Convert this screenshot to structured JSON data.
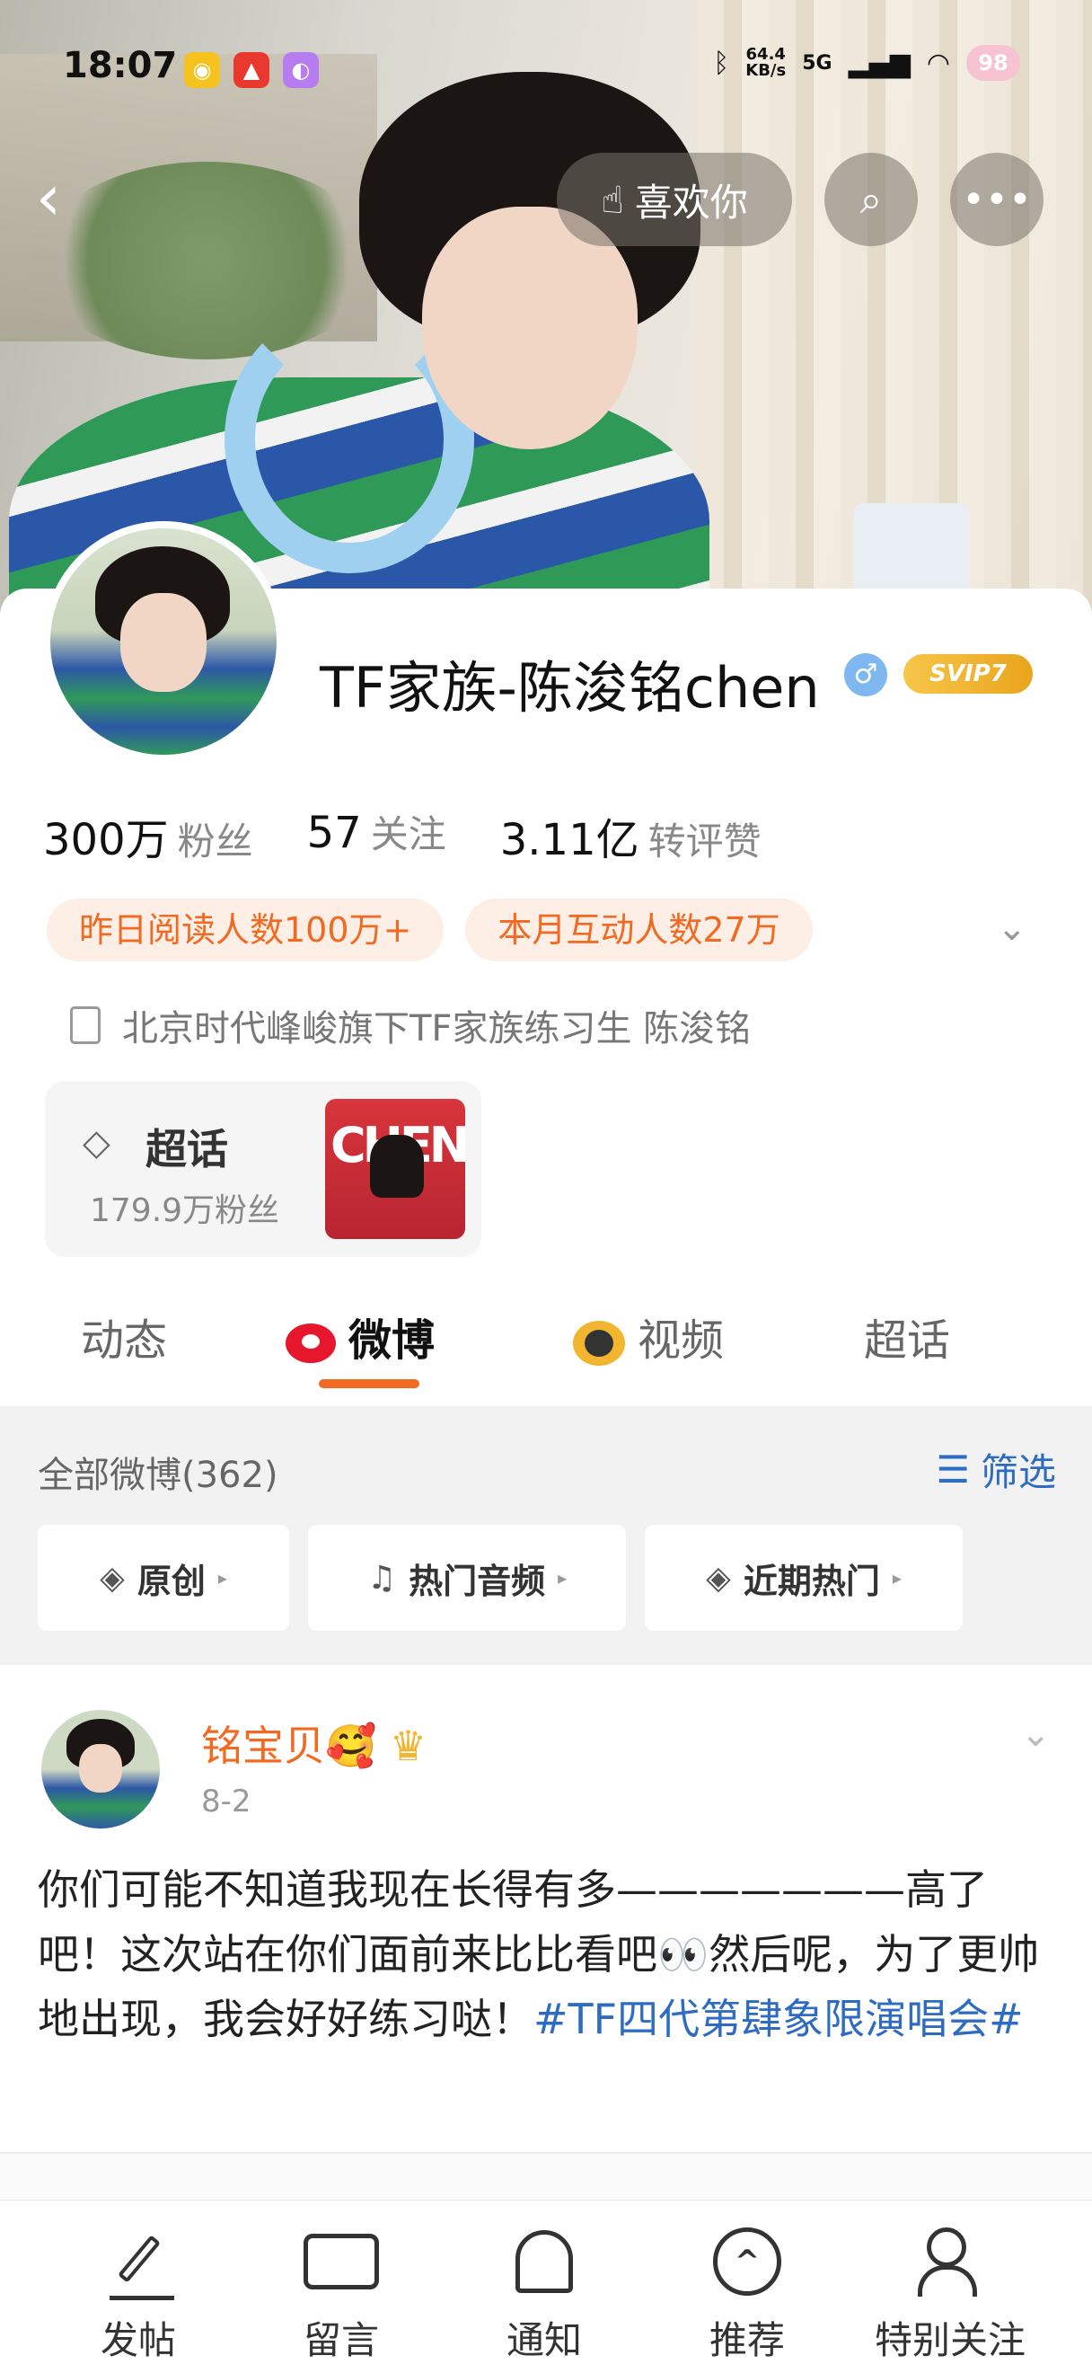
{
  "status_bar": {
    "time": "18:07",
    "net_speed": "64.4",
    "net_unit": "KB/s",
    "network": "5G",
    "battery": "98",
    "apps": [
      {
        "name": "weibo-app-icon",
        "color": "#f6c21d",
        "glyph": "◉"
      },
      {
        "name": "shopping-app-icon",
        "color": "#e9382e",
        "glyph": "▲"
      },
      {
        "name": "purple-app-icon",
        "color": "#b67cf0",
        "glyph": "◐"
      }
    ]
  },
  "header": {
    "like_label": "喜欢你"
  },
  "profile": {
    "username": "TF家族-陈浚铭chen",
    "gender_symbol": "♂",
    "vip_badge": "SVIP7",
    "stats": [
      {
        "value": "300万",
        "label": "粉丝"
      },
      {
        "value": "57",
        "label": "关注"
      },
      {
        "value": "3.11亿",
        "label": "转评赞"
      }
    ],
    "badges": [
      "昨日阅读人数100万+",
      "本月互动人数27万"
    ],
    "bio": "北京时代峰峻旗下TF家族练习生  陈浚铭"
  },
  "supertopic": {
    "title": "超话",
    "fans": "179.9万粉丝",
    "thumb_text": "CHEN"
  },
  "tabs": [
    {
      "label": "动态",
      "active": false
    },
    {
      "label": "微博",
      "active": true
    },
    {
      "label": "视频",
      "active": false
    },
    {
      "label": "超话",
      "active": false
    }
  ],
  "feed_filter": {
    "all_label": "全部微博(362)",
    "filter_label": "筛选",
    "chips": [
      "原创",
      "热门音频",
      "近期热门"
    ]
  },
  "post": {
    "author": "铭宝贝🥰",
    "date": "8-2",
    "text_before": "你们可能不知道我现在长得有多———————高了吧！这次站在你们面前来比比看吧👀然后呢，为了更帅地出现，我会好好练习哒！",
    "hashtag": "#TF四代第肆象限演唱会#"
  },
  "bottom_nav": [
    "发帖",
    "留言",
    "通知",
    "推荐",
    "特别关注"
  ],
  "colors": {
    "accent_orange": "#f26a21",
    "link_blue": "#2e6cc2",
    "badge_bg": "#fdeee6"
  }
}
